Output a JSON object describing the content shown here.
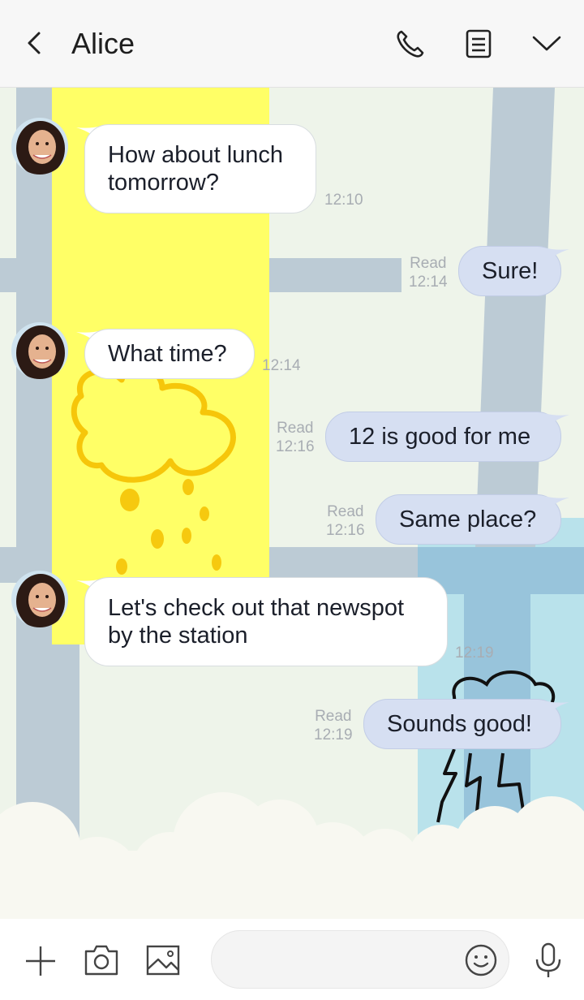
{
  "header": {
    "title": "Alice",
    "back_icon": "chevron-left-icon",
    "call_icon": "phone-icon",
    "notes_icon": "notes-icon",
    "menu_icon": "chevron-down-icon"
  },
  "messages": [
    {
      "direction": "in",
      "lines": [
        "How about lunch",
        "tomorrow?"
      ],
      "time": "12:10"
    },
    {
      "direction": "out",
      "text": "Sure!",
      "status": "Read",
      "time": "12:14"
    },
    {
      "direction": "in",
      "lines": [
        "What time?"
      ],
      "time": "12:14"
    },
    {
      "direction": "out",
      "text": "12 is good for me",
      "status": "Read",
      "time": "12:16"
    },
    {
      "direction": "out",
      "text": "Same place?",
      "status": "Read",
      "time": "12:16"
    },
    {
      "direction": "in",
      "lines": [
        "Let's check out that newspot",
        "by the station"
      ],
      "time": "12:19"
    },
    {
      "direction": "out",
      "text": "Sounds good!",
      "status": "Read",
      "time": "12:19"
    }
  ],
  "footer": {
    "plus_icon": "plus-icon",
    "camera_icon": "camera-icon",
    "image_icon": "image-icon",
    "input_placeholder": "",
    "emoji_icon": "smiley-icon",
    "mic_icon": "microphone-icon"
  },
  "colors": {
    "background": "#eef4ea",
    "incoming_bubble": "#ffffff",
    "outgoing_bubble": "#d6dff2",
    "yellow_block": "#ffff66",
    "road": "#bccbd5",
    "timestamp": "#a8adb3"
  }
}
